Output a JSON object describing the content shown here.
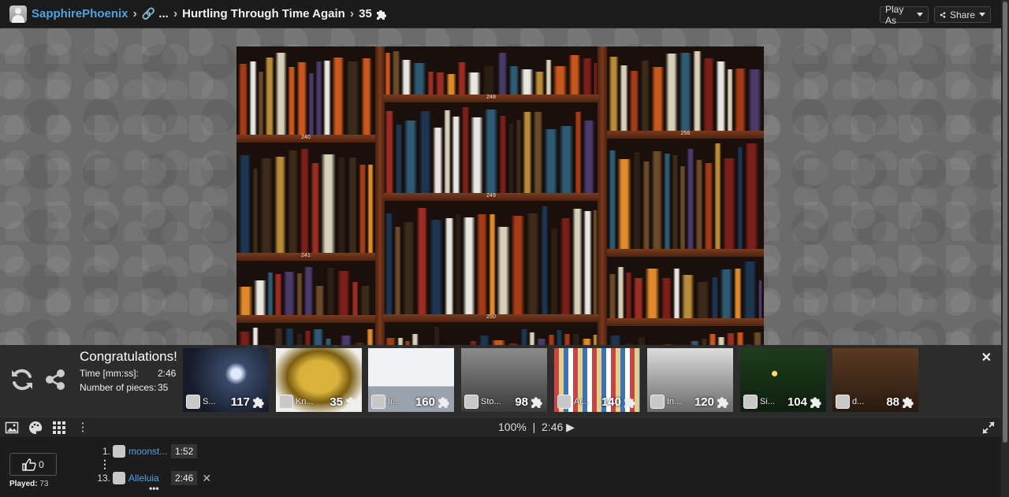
{
  "breadcrumb": {
    "user": "SapphirePhoenix",
    "ellipsis": "...",
    "title": "Hurtling Through Time Again",
    "pieces": "35"
  },
  "header_buttons": {
    "play_as": "Play As",
    "share": "Share"
  },
  "puzzle_image": {
    "shelf_labels": [
      "240",
      "248",
      "256",
      "241",
      "249",
      "250"
    ]
  },
  "completion": {
    "title": "Congratulations!",
    "time_label": "Time [mm:ss]:",
    "time_value": "2:46",
    "pieces_label": "Number of pieces:",
    "pieces_value": "35"
  },
  "suggestions": [
    {
      "name": "S...",
      "count": "117",
      "theme": "flashlight"
    },
    {
      "name": "Kn...",
      "count": "35",
      "theme": "knit hat"
    },
    {
      "name": "Ir...",
      "count": "160",
      "theme": "flag"
    },
    {
      "name": "Sto...",
      "count": "98",
      "theme": "crowd"
    },
    {
      "name": "Ar...",
      "count": "140",
      "theme": "quilt"
    },
    {
      "name": "In...",
      "count": "120",
      "theme": "workers"
    },
    {
      "name": "Si...",
      "count": "104",
      "theme": "christmas dog"
    },
    {
      "name": "d...",
      "count": "88",
      "theme": "library"
    }
  ],
  "status": {
    "zoom": "100%",
    "separator": "|",
    "elapsed": "2:46"
  },
  "likes": {
    "count": "0",
    "played_label": "Played:",
    "played_value": "73"
  },
  "leaderboard": [
    {
      "rank": "1.",
      "name": "moonst...",
      "time": "1:52"
    },
    {
      "rank": "13.",
      "name": "Alleluia",
      "time": "2:46"
    }
  ],
  "colors": {
    "link": "#4fa3e0",
    "background": "#1e1e1e"
  }
}
